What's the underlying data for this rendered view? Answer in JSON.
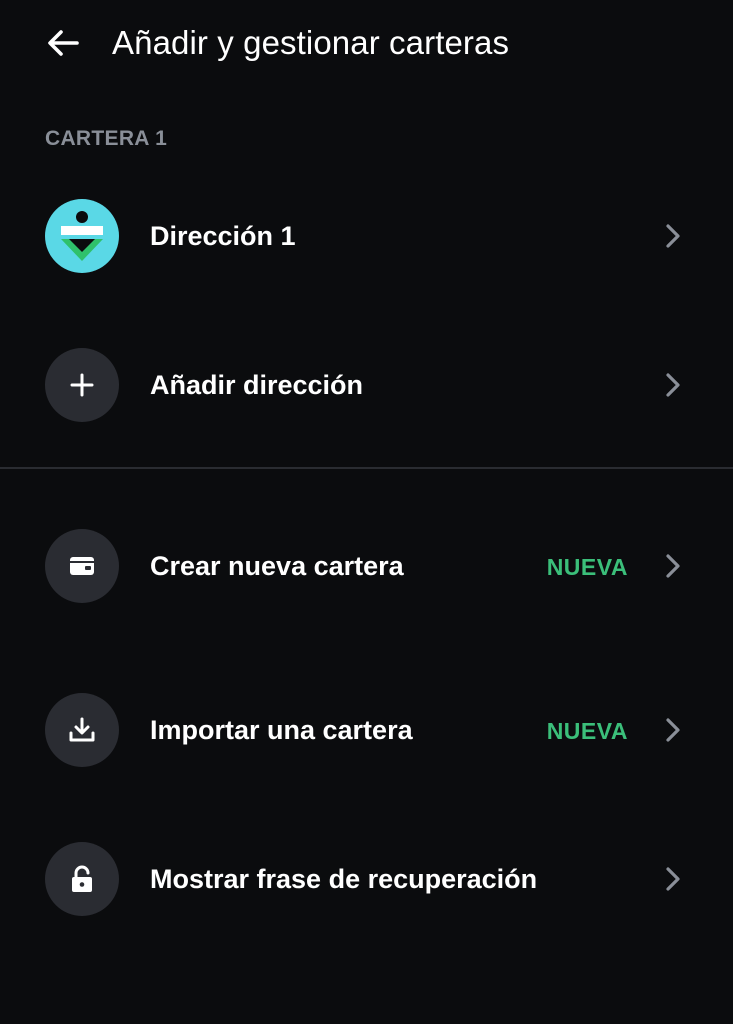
{
  "header": {
    "back_icon": "arrow-left-icon",
    "title": "Añadir y gestionar carteras"
  },
  "wallet_section": {
    "label": "CARTERA 1",
    "items": [
      {
        "label": "Dirección 1",
        "icon": "address-avatar-icon"
      },
      {
        "label": "Añadir dirección",
        "icon": "plus-icon"
      }
    ]
  },
  "actions": [
    {
      "label": "Crear nueva cartera",
      "badge": "NUEVA",
      "icon": "wallet-icon"
    },
    {
      "label": "Importar una cartera",
      "badge": "NUEVA",
      "icon": "import-icon"
    },
    {
      "label": "Mostrar frase de recuperación",
      "icon": "unlock-icon"
    }
  ],
  "colors": {
    "background": "#0b0c0e",
    "icon_circle": "#2a2c32",
    "badge_green": "#3bbf7a",
    "section_label": "#8a8f98",
    "avatar_cyan": "#5ad8e6",
    "avatar_green": "#2fc16b"
  }
}
